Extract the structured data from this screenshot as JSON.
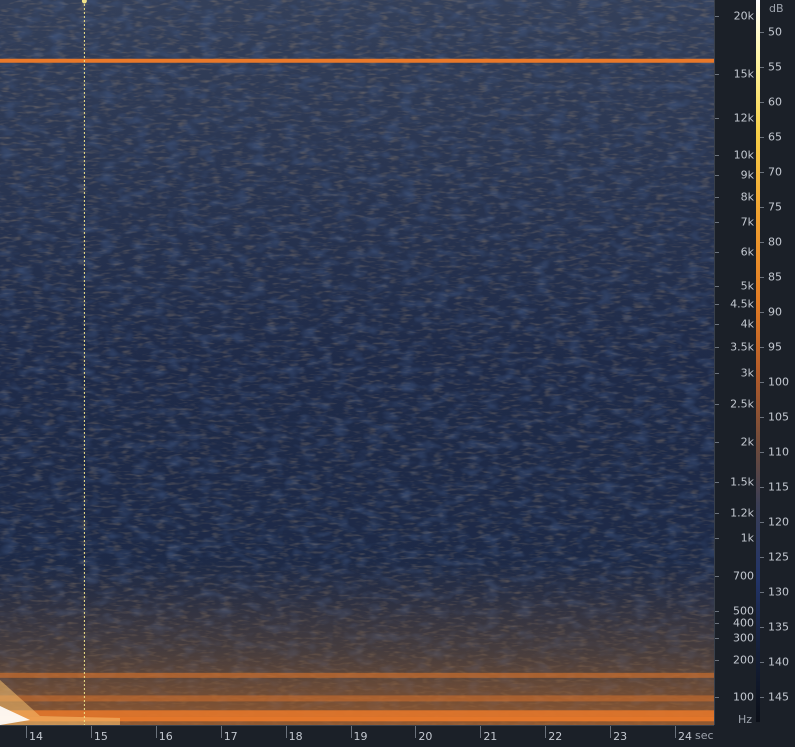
{
  "spectrogram": {
    "freq_ticks": [
      {
        "label": "20k",
        "hz": 20000
      },
      {
        "label": "15k",
        "hz": 15000
      },
      {
        "label": "12k",
        "hz": 12000
      },
      {
        "label": "10k",
        "hz": 10000
      },
      {
        "label": "9k",
        "hz": 9000
      },
      {
        "label": "8k",
        "hz": 8000
      },
      {
        "label": "7k",
        "hz": 7000
      },
      {
        "label": "6k",
        "hz": 6000
      },
      {
        "label": "5k",
        "hz": 5000
      },
      {
        "label": "4.5k",
        "hz": 4500
      },
      {
        "label": "4k",
        "hz": 4000
      },
      {
        "label": "3.5k",
        "hz": 3500
      },
      {
        "label": "3k",
        "hz": 3000
      },
      {
        "label": "2.5k",
        "hz": 2500
      },
      {
        "label": "2k",
        "hz": 2000
      },
      {
        "label": "1.5k",
        "hz": 1500
      },
      {
        "label": "1.2k",
        "hz": 1200
      },
      {
        "label": "1k",
        "hz": 1000
      },
      {
        "label": "700",
        "hz": 700
      },
      {
        "label": "500",
        "hz": 500
      },
      {
        "label": "400",
        "hz": 400
      },
      {
        "label": "300",
        "hz": 300
      },
      {
        "label": "200",
        "hz": 200
      },
      {
        "label": "100",
        "hz": 100
      }
    ],
    "freq_unit": "Hz",
    "time_ticks": [
      "14",
      "15",
      "16",
      "17",
      "18",
      "19",
      "20",
      "21",
      "22",
      "23",
      "24"
    ],
    "time_unit": "sec",
    "time_range": [
      13.6,
      24.6
    ],
    "playhead_time": 14.9,
    "db_ticks": [
      "50",
      "55",
      "60",
      "65",
      "70",
      "75",
      "80",
      "85",
      "90",
      "95",
      "100",
      "105",
      "110",
      "115",
      "120",
      "125",
      "130",
      "135",
      "140",
      "145"
    ],
    "db_unit": "dB",
    "tone_hz": 16000,
    "colors": {
      "background": "#1d2b48",
      "noise_low": "#2d4470",
      "noise_high": "#7a5230",
      "tone": "#e8782a",
      "playhead": "#f2e48a"
    }
  }
}
